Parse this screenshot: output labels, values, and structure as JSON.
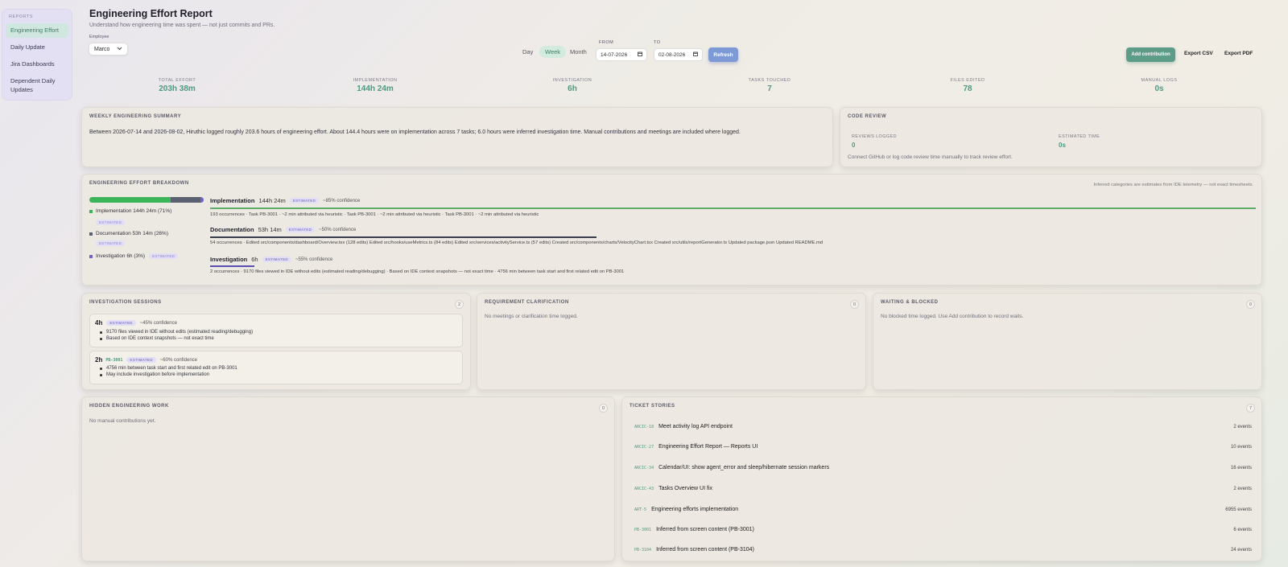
{
  "sidebar": {
    "section": "REPORTS",
    "items": [
      {
        "label": "Engineering Effort"
      },
      {
        "label": "Daily Update"
      },
      {
        "label": "Jira Dashboards"
      },
      {
        "label": "Dependent Daily Updates"
      }
    ]
  },
  "header": {
    "title": "Engineering Effort Report",
    "subtitle": "Understand how engineering time was spent — not just commits and PRs.",
    "employee_label": "Employee",
    "employee_value": "Marco"
  },
  "controls": {
    "day": "Day",
    "week": "Week",
    "month": "Month",
    "from_label": "FROM",
    "to_label": "TO",
    "from_value": "14-07-2026",
    "to_value": "02-08-2026",
    "refresh": "Refresh",
    "add_contribution": "Add contribution",
    "export_csv": "Export CSV",
    "export_pdf": "Export PDF"
  },
  "stats": [
    {
      "label": "TOTAL EFFORT",
      "value": "203h 38m"
    },
    {
      "label": "IMPLEMENTATION",
      "value": "144h 24m"
    },
    {
      "label": "INVESTIGATION",
      "value": "6h"
    },
    {
      "label": "TASKS TOUCHED",
      "value": "7"
    },
    {
      "label": "FILES EDITED",
      "value": "78"
    },
    {
      "label": "MANUAL LOGS",
      "value": "0s"
    }
  ],
  "weekly_summary": {
    "title": "WEEKLY ENGINEERING SUMMARY",
    "text": "Between 2026-07-14 and 2026-08-02, Hiruthic logged roughly 203.6 hours of engineering effort. About 144.4 hours were on implementation across 7 tasks; 6.0 hours were inferred investigation time. Manual contributions and meetings are included where logged."
  },
  "code_review": {
    "title": "CODE REVIEW",
    "reviews_label": "REVIEWS LOGGED",
    "reviews_value": "0",
    "time_label": "ESTIMATED TIME",
    "time_value": "0s",
    "note": "Connect GitHub or log code review time manually to track review effort."
  },
  "breakdown": {
    "title": "ENGINEERING EFFORT BREAKDOWN",
    "note": "Inferred categories are estimates from IDE telemetry — not exact timesheets.",
    "tag": "ESTIMATED",
    "legend": [
      {
        "label": "Implementation",
        "value": "144h 24m (71%)",
        "color": "#3cb55a",
        "share": 0.71
      },
      {
        "label": "Documentation",
        "value": "53h 14m (26%)",
        "color": "#5b6070",
        "share": 0.26
      },
      {
        "label": "Investigation",
        "value": "6h (3%)",
        "color": "#6f63c9",
        "share": 0.03
      }
    ],
    "rows": [
      {
        "name": "Implementation",
        "duration": "144h 24m",
        "confidence": "~85% confidence",
        "color": "#5fae6b",
        "detail": "193 occurrences · Task PB-3001 · ~2 min attributed via heuristic · Task PB-3001 · ~2 min attributed via heuristic · Task PB-3001 · ~2 min attributed via heuristic"
      },
      {
        "name": "Documentation",
        "duration": "53h 14m",
        "confidence": "~50% confidence",
        "color": "#3a3d4a",
        "detail": "54 occurrences · Edited src/components/dashboard/Overview.tsx (128 edits) Edited src/hooks/useMetrics.ts (84 edits) Edited src/services/activityService.ts (57 edits) Created src/components/charts/VelocityChart.tsx Created src/utils/reportGenerator.ts Updated package.json Updated README.md"
      },
      {
        "name": "Investigation",
        "duration": "6h",
        "confidence": "~55% confidence",
        "color": "#5a4fb0",
        "detail": "2 occurrences · 9170 files viewed in IDE without edits (estimated reading/debugging) · Based on IDE context snapshots — not exact time · 4756 min between task start and first related edit on PB-3001"
      }
    ]
  },
  "investigation_sessions": {
    "title": "INVESTIGATION SESSIONS",
    "count": "2",
    "tag": "ESTIMATED",
    "sessions": [
      {
        "duration": "4h",
        "ticket": "",
        "confidence": "~45% confidence",
        "bullets": [
          "9170 files viewed in IDE without edits (estimated reading/debugging)",
          "Based on IDE context snapshots — not exact time"
        ]
      },
      {
        "duration": "2h",
        "ticket": "PB-3001",
        "confidence": "~60% confidence",
        "bullets": [
          "4756 min between task start and first related edit on PB-3001",
          "May include investigation before implementation"
        ]
      }
    ]
  },
  "requirement": {
    "title": "REQUIREMENT CLARIFICATION",
    "count": "0",
    "text": "No meetings or clarification time logged."
  },
  "waiting": {
    "title": "WAITING & BLOCKED",
    "count": "0",
    "text": "No blocked time logged. Use Add contribution to record waits."
  },
  "hidden_work": {
    "title": "HIDDEN ENGINEERING WORK",
    "count": "0",
    "text": "No manual contributions yet."
  },
  "tickets": {
    "title": "TICKET STORIES",
    "count": "7",
    "items": [
      {
        "key": "ARCIC-18",
        "title": "Meet activity log API endpoint",
        "events": "2 events"
      },
      {
        "key": "ARCIC-27",
        "title": "Engineering Effort Report — Reports UI",
        "events": "10 events"
      },
      {
        "key": "ARCIC-34",
        "title": "Calendar/UI: show agent_error and sleep/hibernate session markers",
        "events": "16 events"
      },
      {
        "key": "ARCIC-43",
        "title": "Tasks Overview UI fix",
        "events": "2 events"
      },
      {
        "key": "ART-5",
        "title": "Engineering efforts implementation",
        "events": "6955 events"
      },
      {
        "key": "PB-3001",
        "title": "Inferred from screen content (PB-3001)",
        "events": "6 events"
      },
      {
        "key": "PB-3104",
        "title": "Inferred from screen content (PB-3104)",
        "events": "24 events"
      }
    ]
  }
}
